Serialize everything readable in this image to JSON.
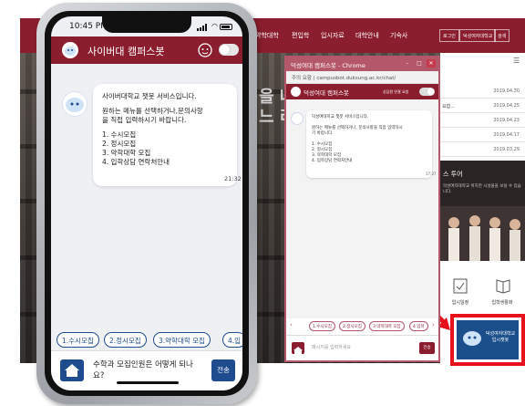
{
  "site": {
    "nav": [
      "약학대학",
      "편입학",
      "입시자료",
      "대학안내",
      "기숙사"
    ],
    "nav_buttons": [
      "로그인",
      "덕성여자대학교",
      "검색"
    ],
    "hero_lines": [
      "을 나",
      "느 리"
    ],
    "notices": [
      {
        "title": "",
        "date": "2019.04.30"
      },
      {
        "title": "요합...",
        "date": "2019.04.25"
      },
      {
        "title": "",
        "date": "2019.04.23"
      },
      {
        "title": "",
        "date": "2019.04.17"
      },
      {
        "title": "",
        "date": "2019.03.29"
      }
    ],
    "campus_tour_title": "스 투어",
    "campus_tour_sub": "덕성여자대학교 위치한 시설물을\n보실 수 있습니다.",
    "tiles": [
      "입시일정",
      "입학생활화"
    ],
    "launcher_label": "덕성여자대학교 입시챗봇"
  },
  "popup": {
    "title": "덕성여대 캠퍼스봇 - Chrome",
    "url": "주의 요함 | campusbot.duksung.ac.kr/chat/",
    "header_title": "덕성여대 캠퍼스봇",
    "header_right": "상담원 연결 요청",
    "message_lines": [
      "덕성여대학교 챗봇 서비스입니다.",
      "",
      "원하는 메뉴를 선택하거나, 문의사항을 직접 입력하시",
      "기 바랍니다.",
      "",
      "1. 수시모집",
      "2. 정시모집",
      "3. 약학대학 모집",
      "4. 입학상담 연락처안내"
    ],
    "time": "17:27",
    "chips": [
      "1.수시모집",
      "2.정시모집",
      "3.약학대학 모집",
      "4.입학"
    ],
    "placeholder": "메시지를 입력하세요",
    "send": "전송"
  },
  "phone": {
    "status_time": "10:45 PM",
    "app_title": "사이버대 캠퍼스봇",
    "message_lines": [
      "사이버대학교 챗봇 서비스입니다.",
      "",
      "원하는 메뉴를 선택하거나,문의사항",
      "을 직접 입력하시기 바랍니다.",
      "",
      "1. 수시모집",
      "2. 정시모집",
      "3. 약학대학 모집",
      "4. 입학상담 연락처안내"
    ],
    "time": "21:32",
    "chips": [
      "1.수시모집",
      "2.정시모집",
      "3.약학대학 모집",
      "4.입"
    ],
    "input_text": "수학과 모집인원은 어떻게 되나요?",
    "send": "전송"
  },
  "colors": {
    "brand": "#8b1e2e",
    "accent_blue": "#1e4c8f",
    "highlight": "#e8111b"
  }
}
